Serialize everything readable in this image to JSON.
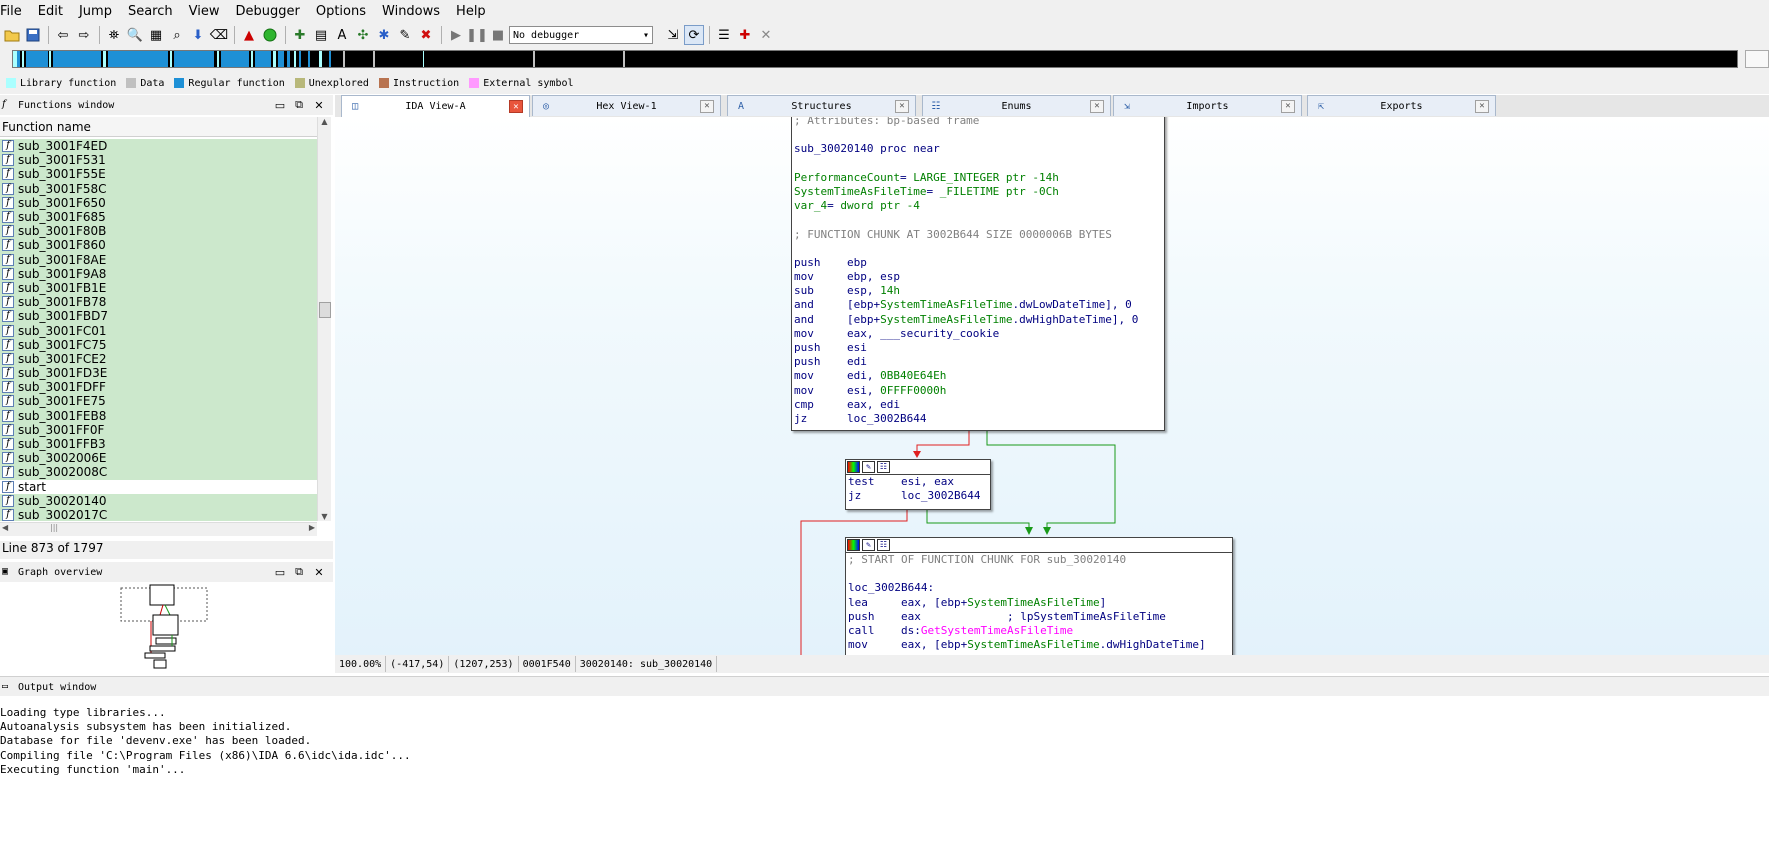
{
  "menu": [
    "File",
    "Edit",
    "Jump",
    "Search",
    "View",
    "Debugger",
    "Options",
    "Windows",
    "Help"
  ],
  "toolbar": {
    "debugger_selected": "No debugger"
  },
  "legend": [
    {
      "label": "Library function",
      "color": "#aaffff"
    },
    {
      "label": "Data",
      "color": "#c0c0c0"
    },
    {
      "label": "Regular function",
      "color": "#1e90d6"
    },
    {
      "label": "Unexplored",
      "color": "#b8b87a"
    },
    {
      "label": "Instruction",
      "color": "#b87350"
    },
    {
      "label": "External symbol",
      "color": "#ff99ff"
    }
  ],
  "functions_window": {
    "title": "Functions window",
    "column_header": "Function name",
    "items": [
      "sub_3001F4ED",
      "sub_3001F531",
      "sub_3001F55E",
      "sub_3001F58C",
      "sub_3001F650",
      "sub_3001F685",
      "sub_3001F80B",
      "sub_3001F860",
      "sub_3001F8AE",
      "sub_3001F9A8",
      "sub_3001FB1E",
      "sub_3001FB78",
      "sub_3001FBD7",
      "sub_3001FC01",
      "sub_3001FC75",
      "sub_3001FCE2",
      "sub_3001FD3E",
      "sub_3001FDFF",
      "sub_3001FE75",
      "sub_3001FEB8",
      "sub_3001FF0F",
      "sub_3001FFB3",
      "sub_3002006E",
      "sub_3002008C",
      "start",
      "sub_30020140",
      "sub_3002017C"
    ],
    "status": "Line 873 of 1797"
  },
  "graph_overview": {
    "title": "Graph overview"
  },
  "tabs": [
    {
      "label": "IDA View-A",
      "icon": "graph-icon",
      "active": true
    },
    {
      "label": "Hex View-1",
      "icon": "hex-icon",
      "active": false
    },
    {
      "label": "Structures",
      "icon": "structures-icon",
      "active": false
    },
    {
      "label": "Enums",
      "icon": "enums-icon",
      "active": false
    },
    {
      "label": "Imports",
      "icon": "imports-icon",
      "active": false
    },
    {
      "label": "Exports",
      "icon": "exports-icon",
      "active": false
    }
  ],
  "nodes": {
    "main": [
      "; Attributes: bp-based frame",
      "",
      "sub_30020140 proc near",
      "",
      "PerformanceCount= LARGE_INTEGER ptr -14h",
      "SystemTimeAsFileTime= _FILETIME ptr -0Ch",
      "var_4= dword ptr -4",
      "",
      "; FUNCTION CHUNK AT 3002B644 SIZE 0000006B BYTES",
      "",
      "push    ebp",
      "mov     ebp, esp",
      "sub     esp, 14h",
      "and     [ebp+SystemTimeAsFileTime.dwLowDateTime], 0",
      "and     [ebp+SystemTimeAsFileTime.dwHighDateTime], 0",
      "mov     eax, ___security_cookie",
      "push    esi",
      "push    edi",
      "mov     edi, 0BB40E64Eh",
      "mov     esi, 0FFFF0000h",
      "cmp     eax, edi",
      "jz      loc_3002B644"
    ],
    "test": [
      "test    esi, eax",
      "jz      loc_3002B644"
    ],
    "chunk": [
      "; START OF FUNCTION CHUNK FOR sub_30020140",
      "",
      "loc_3002B644:",
      "lea     eax, [ebp+SystemTimeAsFileTime]",
      "push    eax             ; lpSystemTimeAsFileTime",
      "call    ds:GetSystemTimeAsFileTime",
      "mov     eax, [ebp+SystemTimeAsFileTime.dwHighDateTime]"
    ]
  },
  "graph_status": {
    "zoom": "100.00%",
    "cursor": "(-417,54)",
    "graph_pos": "(1207,253)",
    "file_offset": "0001F540",
    "location": "30020140: sub_30020140"
  },
  "output_window": {
    "title": "Output window",
    "lines": [
      "Loading type libraries...",
      "Autoanalysis subsystem has been initialized.",
      "Database for file 'devenv.exe' has been loaded.",
      "Compiling file 'C:\\Program Files (x86)\\IDA 6.6\\idc\\ida.idc'...",
      "Executing function 'main'..."
    ]
  },
  "colors": {
    "node_text": "#000080",
    "comment": "#808080",
    "variable": "#008000",
    "api": "#ff00ff",
    "edge_false": "#e02020",
    "edge_true": "#1a9a1a",
    "function_row": "#cce8cc"
  }
}
